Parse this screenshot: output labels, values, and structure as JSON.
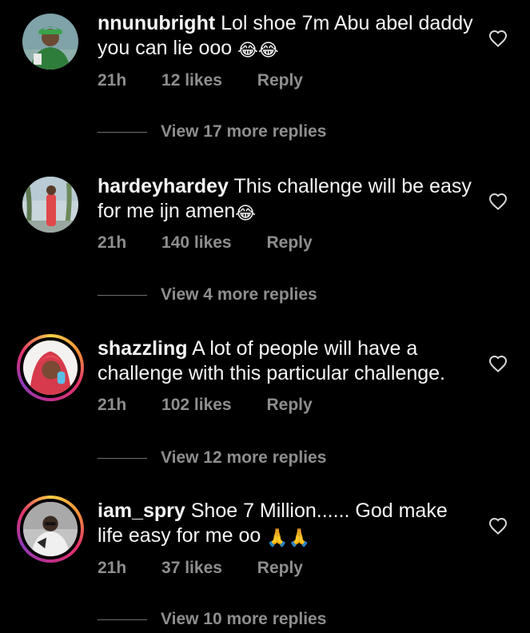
{
  "comments": [
    {
      "username": "nnunubright",
      "text": "Lol shoe 7m Abu abel daddy you can lie ooo",
      "emojis": "😂😂",
      "time": "21h",
      "likes": "12 likes",
      "reply": "Reply",
      "view_replies": "View 17 more replies",
      "avatar_ring": false
    },
    {
      "username": "hardeyhardey",
      "text": "This challenge will be easy for me ijn amen",
      "emojis": "😂",
      "time": "21h",
      "likes": "140 likes",
      "reply": "Reply",
      "view_replies": "View 4 more replies",
      "avatar_ring": false
    },
    {
      "username": "shazzling",
      "text": "A lot of people will have a challenge with this particular challenge.",
      "emojis": "",
      "time": "21h",
      "likes": "102 likes",
      "reply": "Reply",
      "view_replies": "View 12 more replies",
      "avatar_ring": true
    },
    {
      "username": "iam_spry",
      "text": "Shoe 7 Million...... God make life easy for me oo",
      "emojis": "🙏🙏",
      "time": "21h",
      "likes": "37 likes",
      "reply": "Reply",
      "view_replies": "View 10 more replies",
      "avatar_ring": true
    }
  ],
  "icons": {
    "like": "heart-outline-icon"
  },
  "colors": {
    "background": "#000000",
    "text": "#f5f5f5",
    "secondary": "#8e8e8e"
  }
}
